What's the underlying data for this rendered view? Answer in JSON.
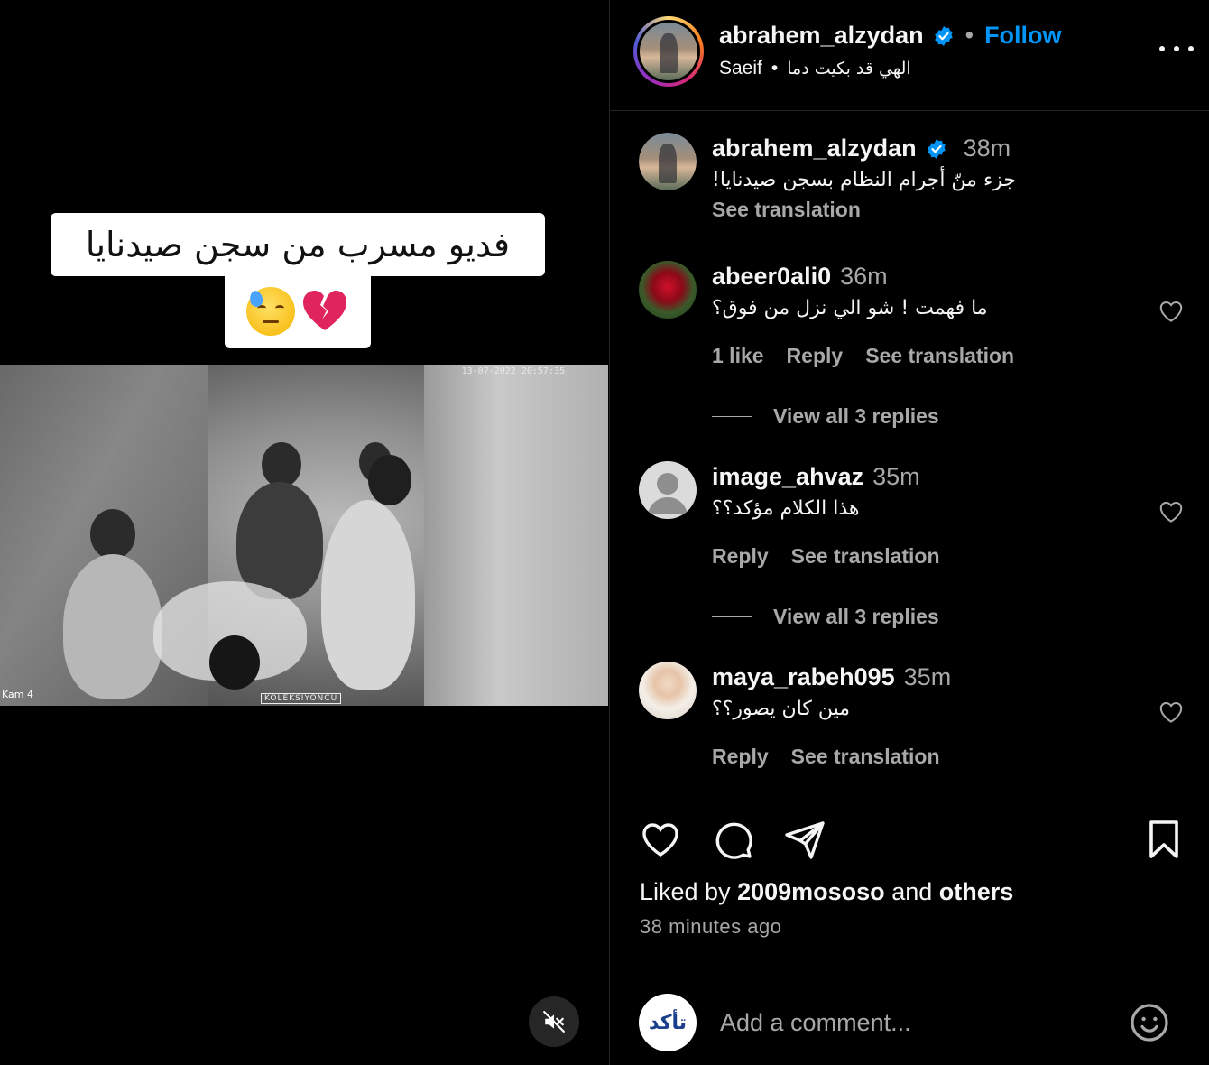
{
  "media": {
    "overlay_text": "فديو مسرب من سجن صيدنايا",
    "cam_timestamp": "13-07-2022 20:57:35",
    "cam_label": "Kam 4",
    "watermark": "KOLEKSIYONCU",
    "mute_icon": "speaker-muted-icon"
  },
  "header": {
    "username": "abrahem_alzydan",
    "dot": "•",
    "follow_label": "Follow",
    "sub_name": "Saeif",
    "sub_dot": "•",
    "audio": "الهي قد بكيت دما"
  },
  "caption": {
    "username": "abrahem_alzydan",
    "time": "38m",
    "text": "جزء منّ أجرام النظام بسجن صيدنايا!",
    "see_translation": "See translation"
  },
  "comments": [
    {
      "username": "abeer0ali0",
      "time": "36m",
      "text": "ما فهمت ! شو الي نزل من فوق؟",
      "likes": "1 like",
      "reply": "Reply",
      "see_translation": "See translation",
      "view_replies": "View all 3 replies"
    },
    {
      "username": "image_ahvaz",
      "time": "35m",
      "text": "هذا الكلام مؤكد؟؟",
      "reply": "Reply",
      "see_translation": "See translation",
      "view_replies": "View all 3 replies"
    },
    {
      "username": "maya_rabeh095",
      "time": "35m",
      "text": "مين كان يصور؟؟",
      "reply": "Reply",
      "see_translation": "See translation"
    }
  ],
  "actions": {
    "liked_prefix": "Liked by",
    "liked_user": "2009mososo",
    "liked_and": "and",
    "liked_others": "others",
    "time_ago": "38 minutes ago"
  },
  "comment_box": {
    "placeholder": "Add a comment...",
    "avatar_text": "تأكد"
  },
  "colors": {
    "accent": "#0095f6",
    "secondary_text": "#a8a8a8",
    "divider": "#262626"
  }
}
